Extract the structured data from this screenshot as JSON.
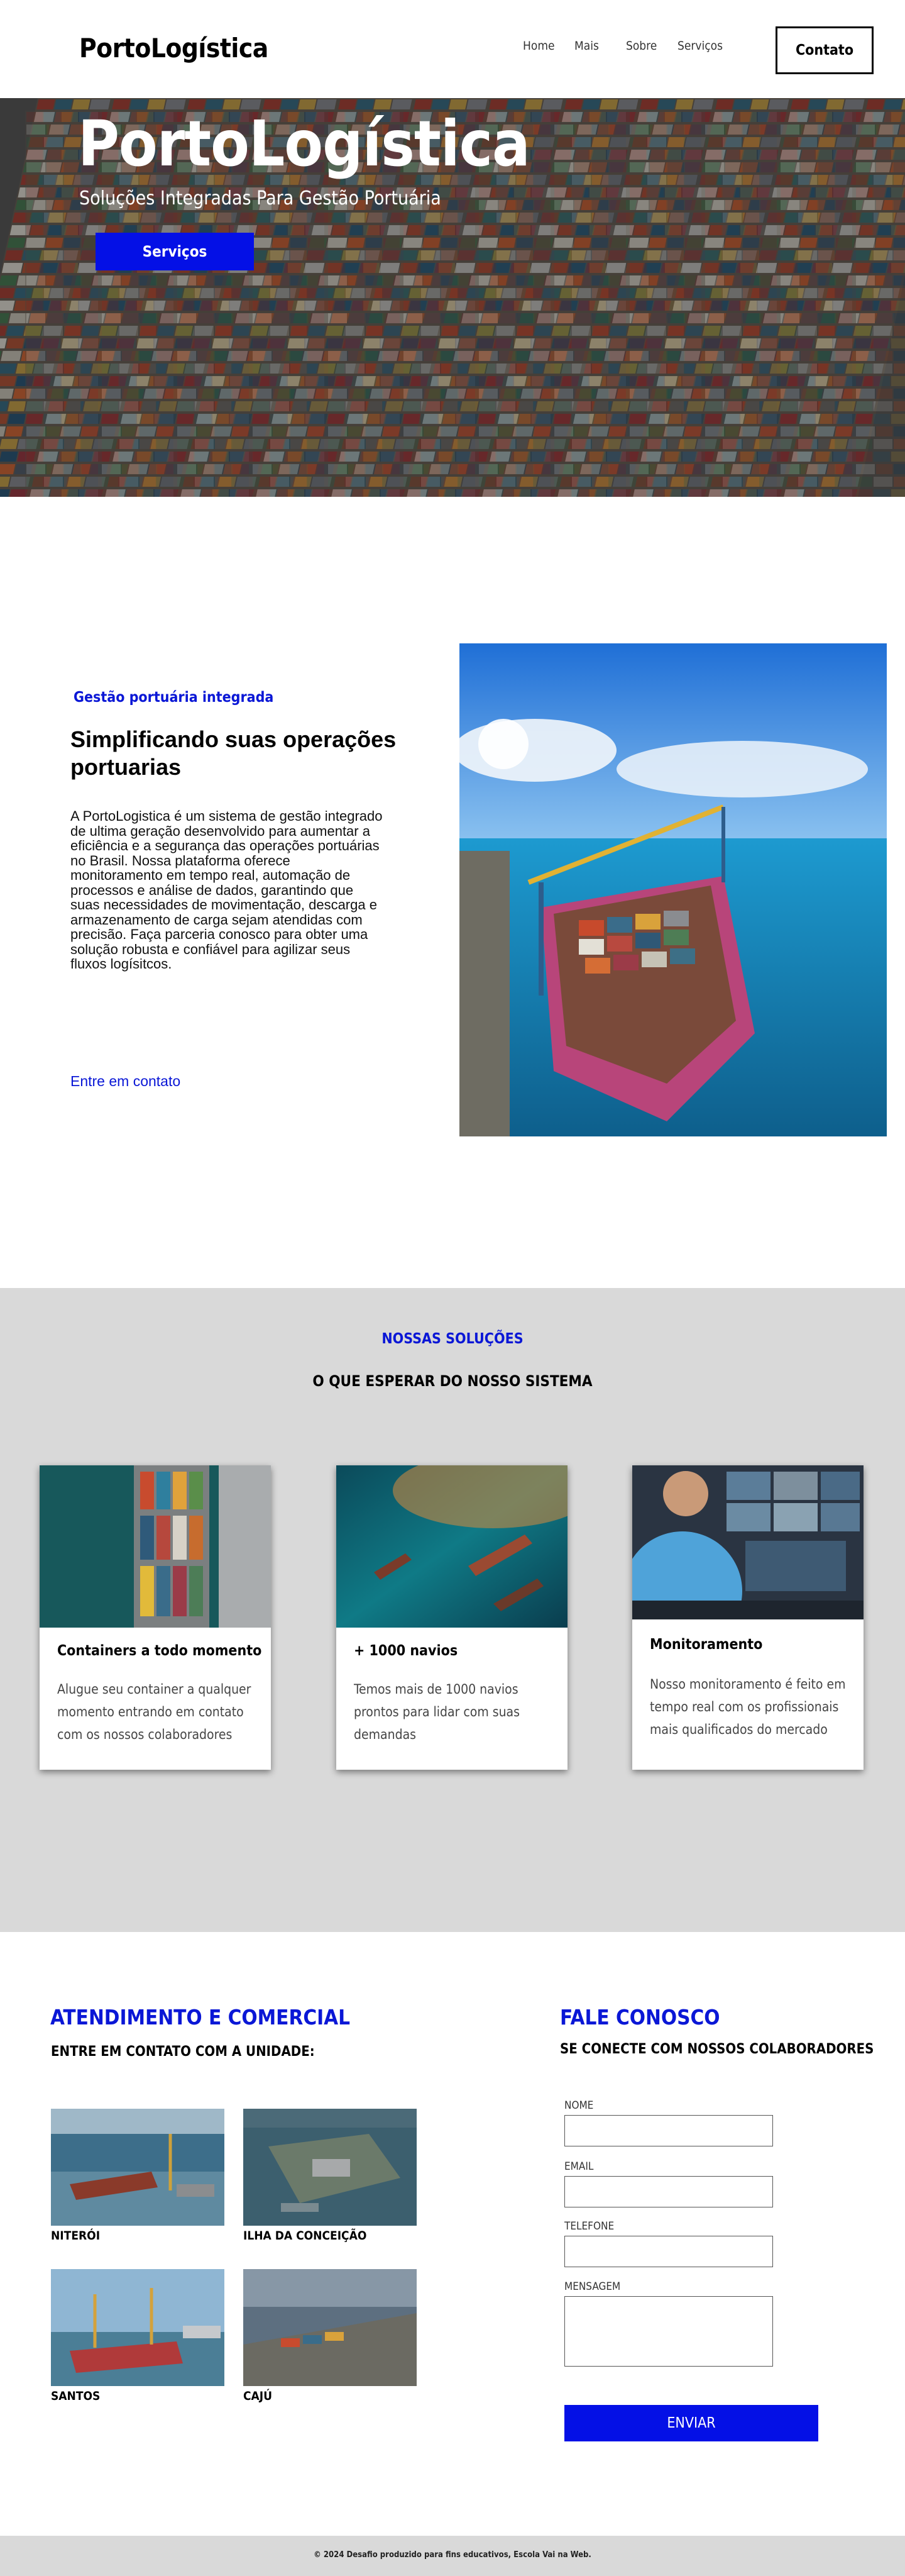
{
  "header": {
    "logo": "PortoLogística",
    "nav": [
      "Home",
      "Mais",
      "Sobre",
      "Serviços"
    ],
    "contact_button": "Contato"
  },
  "hero": {
    "title": "PortoLogística",
    "subtitle": "Soluções Integradas Para Gestão Portuária",
    "button": "Serviços"
  },
  "about": {
    "eyebrow": "Gestão portuária integrada",
    "title": "Simplificando suas operações portuarias",
    "body": " A PortoLogistica é um sistema de gestão integrado de ultima geração desenvolvido para aumentar a eficiência e a segurança das operações portuárias no Brasil. Nossa plataforma oferece monitoramento em tempo real, automação de processos e análise de dados, garantindo que suas necessidades de movimentação, descarga e armazenamento de carga sejam atendidas com precisão. Faça parceria conosco para obter uma solução robusta e confiável para agilizar seus fluxos logísitcos.",
    "link": "Entre em contato"
  },
  "solutions": {
    "eyebrow": "NOSSAS SOLUÇÕES",
    "title": "O QUE ESPERAR DO NOSSO SISTEMA",
    "cards": [
      {
        "title": "Containers a todo momento",
        "text": "Alugue seu container a qualquer momento entrando em contato com os nossos colaboradores"
      },
      {
        "title": "+ 1000 navios",
        "text": "Temos mais de 1000 navios prontos para lidar com suas demandas"
      },
      {
        "title": "Monitoramento",
        "text": "Nosso monitoramento é feito em tempo real com os profissionais mais qualificados do mercado"
      }
    ]
  },
  "units": {
    "title": "ATENDIMENTO E COMERCIAL",
    "subtitle": "ENTRE EM CONTATO COM A UNIDADE:",
    "items": [
      "NITERÓI",
      "ILHA DA CONCEIÇÃO",
      "SANTOS",
      "CAJÚ"
    ]
  },
  "contact_form": {
    "title": "FALE CONOSCO",
    "subtitle": "SE CONECTE COM NOSSOS COLABORADORES",
    "fields": [
      "NOME",
      "EMAIL",
      "TELEFONE",
      "MENSAGEM"
    ],
    "submit": "ENVIAR"
  },
  "footer": {
    "text": "© 2024 Desafio produzido para fins educativos, Escola Vai na Web."
  },
  "colors": {
    "accent": "#0410e6",
    "section_gray": "#d9d9d9"
  }
}
